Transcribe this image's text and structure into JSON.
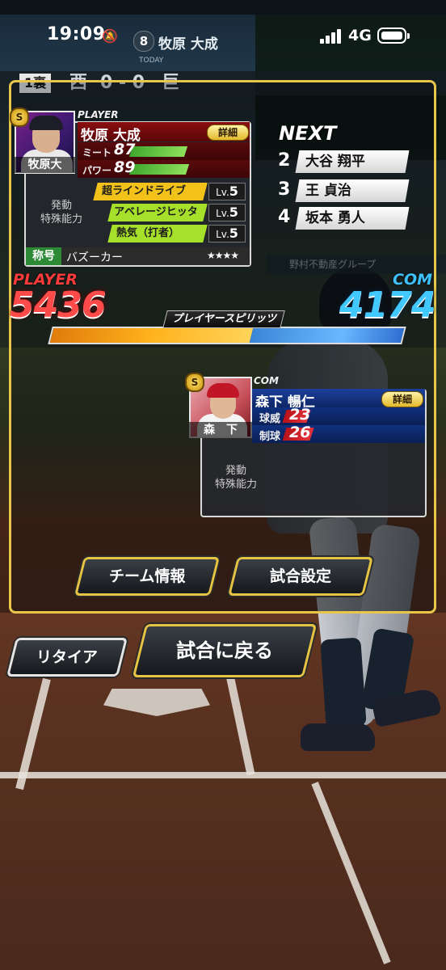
{
  "status_bar": {
    "time": "19:09",
    "network": "4G"
  },
  "scoreboard": {
    "batter_number": "8",
    "batter_name": "牧原 大成",
    "today_label": "TODAY",
    "inning": "1裏",
    "away": "西",
    "home": "巨",
    "score": "0 - 0"
  },
  "player": {
    "section_label": "PLAYER",
    "name": "牧原 大成",
    "short_name": "牧原大",
    "rank": "S",
    "detail_label": "詳細",
    "stats": [
      {
        "label": "ミート",
        "value": "87"
      },
      {
        "label": "パワー",
        "value": "89"
      }
    ],
    "ability_label": "発動\n特殊能力",
    "abilities": [
      {
        "name": "超ラインドライブ",
        "level": "5",
        "color": "#f2c21b"
      },
      {
        "name": "アベレージヒッター",
        "level": "5",
        "color": "#a6e02a"
      },
      {
        "name": "熱気（打者）",
        "level": "5",
        "color": "#a6e02a"
      }
    ],
    "lv_prefix": "Lv.",
    "title_tag": "称号",
    "title_value": "バズーカー",
    "title_stars": "★★★★"
  },
  "next": {
    "label": "NEXT",
    "batters": [
      {
        "order": "2",
        "name": "大谷 翔平"
      },
      {
        "order": "3",
        "name": "王 貞治"
      },
      {
        "order": "4",
        "name": "坂本 勇人"
      }
    ]
  },
  "spirits": {
    "player_label": "PLAYER",
    "player_score": "5436",
    "com_label": "COM",
    "com_score": "4174",
    "bar_label": "プレイヤースピリッツ",
    "player_ratio": 0.57
  },
  "com": {
    "section_label": "COM",
    "name": "森下 暢仁",
    "short_name": "森　下",
    "rank": "S",
    "detail_label": "詳細",
    "stats": [
      {
        "label": "球威",
        "value": "23"
      },
      {
        "label": "制球",
        "value": "26"
      }
    ],
    "ability_label": "発動\n特殊能力"
  },
  "buttons": {
    "team_info": "チーム情報",
    "match_settings": "試合設定",
    "retire": "リタイア",
    "return_to_match": "試合に戻る"
  },
  "background": {
    "sponsor": "野村不動産グループ"
  },
  "colors": {
    "frame_accent": "#e9c64a",
    "player_red": "#ff4a4a",
    "com_blue": "#40c8ff"
  }
}
